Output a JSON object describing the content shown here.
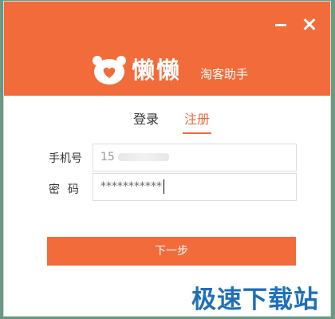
{
  "window": {
    "brand_name": "懒懒",
    "brand_subtitle": "淘客助手",
    "accent_color": "#f26b3a"
  },
  "tabs": [
    {
      "label": "登录",
      "active": false
    },
    {
      "label": "注册",
      "active": true
    }
  ],
  "form": {
    "phone_label": "手机号",
    "phone_value": "15",
    "password_label": "密码",
    "password_value": "***********"
  },
  "actions": {
    "next_label": "下一步"
  },
  "watermark": "极速下载站",
  "icons": [
    "minimize-icon",
    "close-icon",
    "bear-logo-icon"
  ]
}
